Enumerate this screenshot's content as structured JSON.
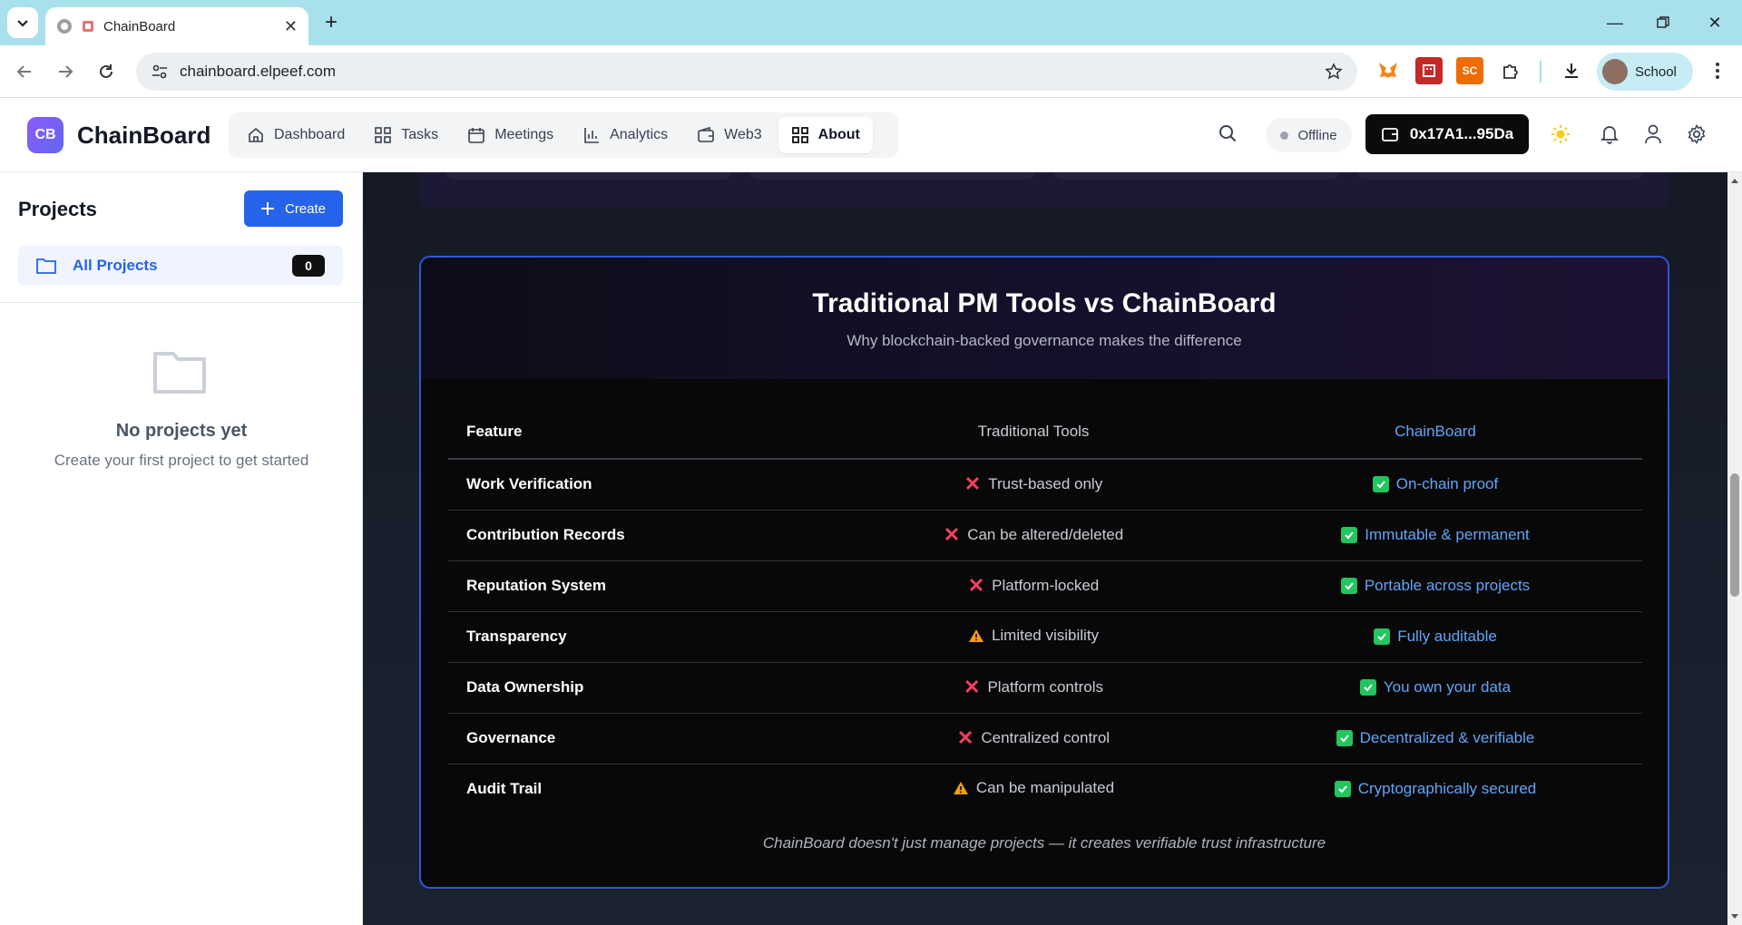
{
  "browser": {
    "tab_title": "ChainBoard",
    "url": "chainboard.elpeef.com",
    "profile_label": "School",
    "extensions": [
      {
        "name": "metamask-extension-icon",
        "color": "#f6851b"
      },
      {
        "name": "red-extension-icon",
        "color": "#c62828"
      },
      {
        "name": "sc-extension-icon",
        "text": "SC",
        "color": "#ef6c00"
      }
    ]
  },
  "app": {
    "logo_initials": "CB",
    "name": "ChainBoard",
    "nav": [
      {
        "label": "Dashboard",
        "icon": "home-icon"
      },
      {
        "label": "Tasks",
        "icon": "grid-icon"
      },
      {
        "label": "Meetings",
        "icon": "calendar-icon"
      },
      {
        "label": "Analytics",
        "icon": "bar-chart-icon"
      },
      {
        "label": "Web3",
        "icon": "wallet-icon"
      },
      {
        "label": "About",
        "icon": "grid-icon",
        "active": true
      }
    ],
    "status": "Offline",
    "wallet_address": "0x17A1...95Da"
  },
  "sidebar": {
    "title": "Projects",
    "create_label": "Create",
    "all_projects_label": "All Projects",
    "all_projects_count": "0",
    "empty_title": "No projects yet",
    "empty_subtitle": "Create your first project to get started"
  },
  "comparison": {
    "title": "Traditional PM Tools vs ChainBoard",
    "subtitle": "Why blockchain-backed governance makes the difference",
    "headers": {
      "feature": "Feature",
      "traditional": "Traditional Tools",
      "chainboard": "ChainBoard"
    },
    "rows": [
      {
        "feature": "Work Verification",
        "traditional": "Trust-based only",
        "trad_mark": "cross",
        "chainboard": "On-chain proof"
      },
      {
        "feature": "Contribution Records",
        "traditional": "Can be altered/deleted",
        "trad_mark": "cross",
        "chainboard": "Immutable & permanent"
      },
      {
        "feature": "Reputation System",
        "traditional": "Platform-locked",
        "trad_mark": "cross",
        "chainboard": "Portable across projects"
      },
      {
        "feature": "Transparency",
        "traditional": "Limited visibility",
        "trad_mark": "warning",
        "chainboard": "Fully auditable"
      },
      {
        "feature": "Data Ownership",
        "traditional": "Platform controls",
        "trad_mark": "cross",
        "chainboard": "You own your data"
      },
      {
        "feature": "Governance",
        "traditional": "Centralized control",
        "trad_mark": "cross",
        "chainboard": "Decentralized & verifiable"
      },
      {
        "feature": "Audit Trail",
        "traditional": "Can be manipulated",
        "trad_mark": "warning",
        "chainboard": "Cryptographically secured"
      }
    ],
    "footer": "ChainBoard doesn't just manage projects — it creates verifiable trust infrastructure"
  }
}
